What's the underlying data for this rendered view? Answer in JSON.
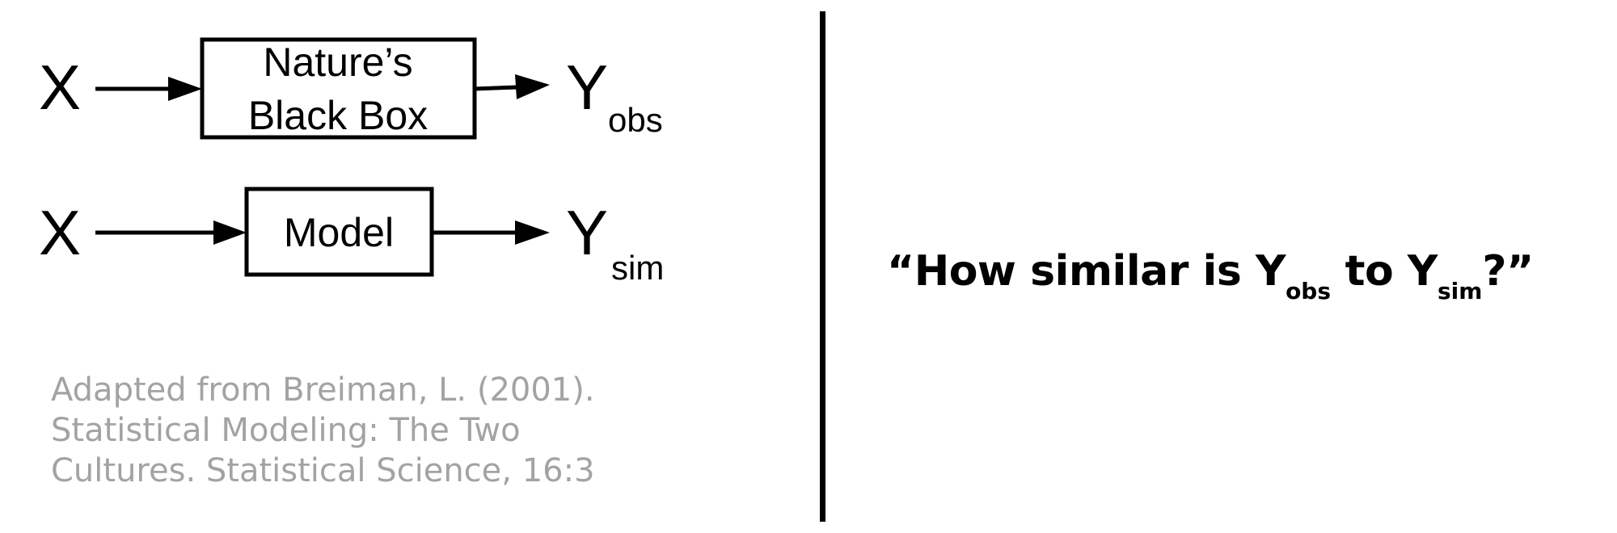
{
  "diagram": {
    "row1": {
      "input_label": "X",
      "box_line1": "Nature’s",
      "box_line2": "Black Box",
      "output_label": "Y",
      "output_subscript": "obs"
    },
    "row2": {
      "input_label": "X",
      "box_label": "Model",
      "output_label": "Y",
      "output_subscript": "sim"
    },
    "stroke_color": "#000000"
  },
  "citation": {
    "line1": "Adapted from Breiman, L. (2001).",
    "line2": "Statistical Modeling: The Two",
    "line3": "Cultures. Statistical Science, 16:3",
    "color": "#a3a3a3"
  },
  "question": {
    "open_quote": "“",
    "part1": "How similar is Y",
    "sub1": "obs",
    "part2": " to Y",
    "sub2": "sim",
    "part3": "?",
    "close_quote": "”"
  }
}
